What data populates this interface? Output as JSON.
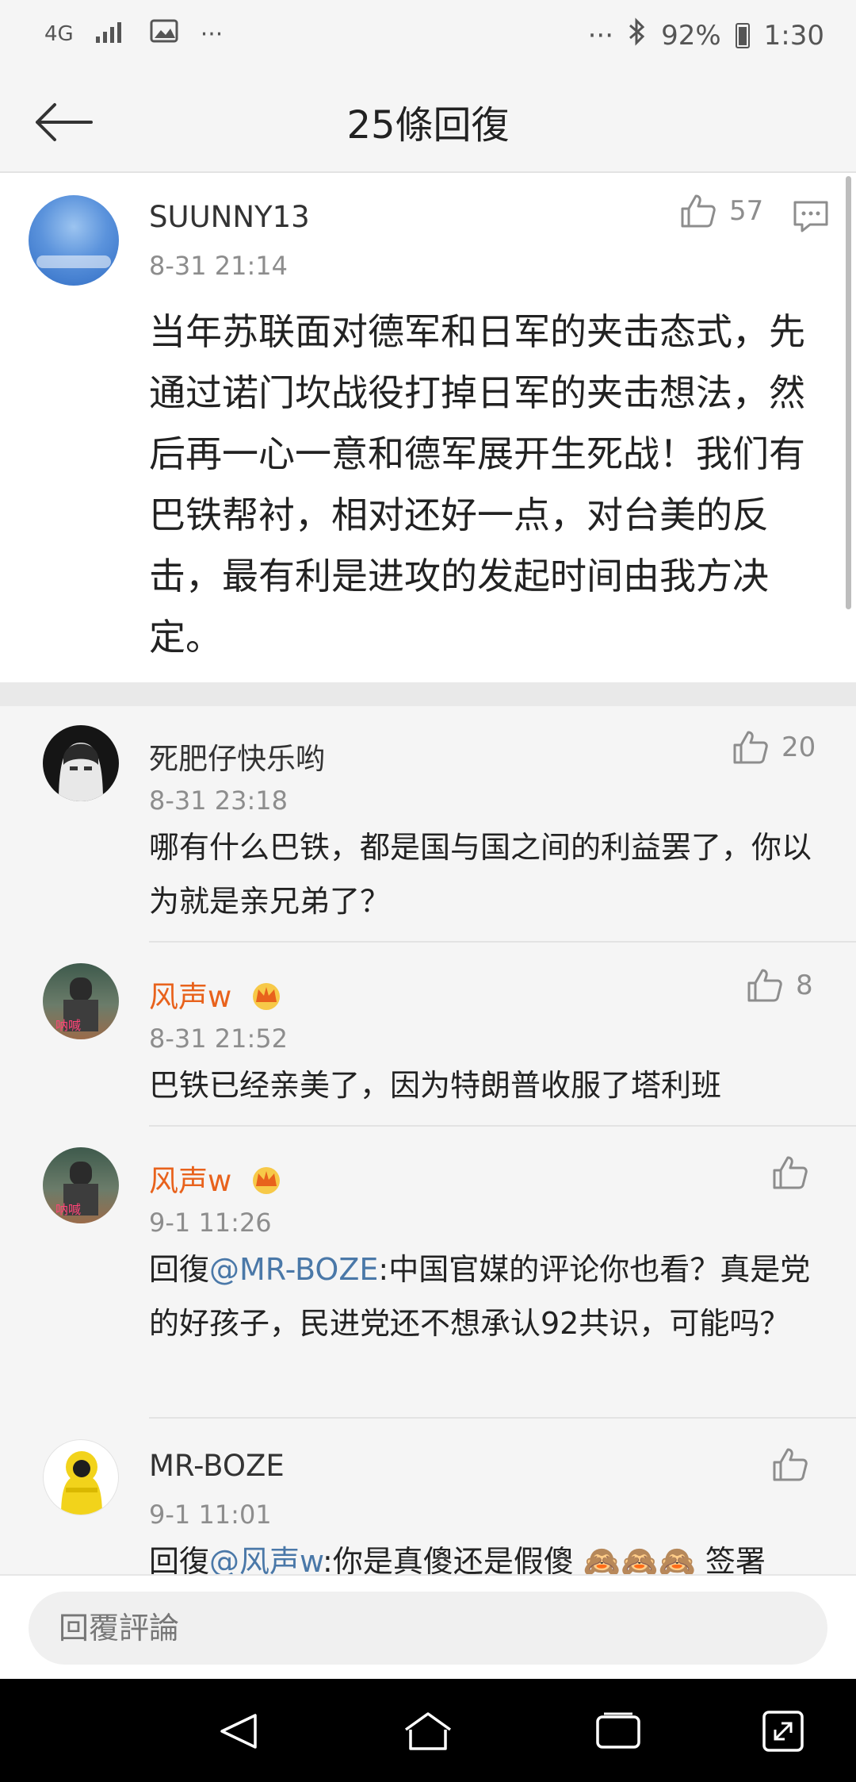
{
  "status_bar": {
    "network": "4G",
    "more_left": "···",
    "more_right": "···",
    "battery": "92%",
    "time": "1:30"
  },
  "header": {
    "title": "25條回復"
  },
  "main_comment": {
    "username": "SUUNNY13",
    "timestamp": "8-31 21:14",
    "likes": "57",
    "body": "当年苏联面对德军和日军的夹击态式，先通过诺门坎战役打掉日军的夹击想法，然后再一心一意和德军展开生死战！我们有巴铁帮衬，相对还好一点，对台美的反击，最有利是进攻的发起时间由我方决定。"
  },
  "replies": [
    {
      "username": "死肥仔快乐哟",
      "timestamp": "8-31 23:18",
      "likes": "20",
      "body": "哪有什么巴铁，都是国与国之间的利益罢了，你以为就是亲兄弟了？"
    },
    {
      "username": "风声w",
      "timestamp": "8-31 21:52",
      "likes": "8",
      "body": "巴铁已经亲美了，因为特朗普收服了塔利班"
    },
    {
      "username": "风声w",
      "timestamp": "9-1 11:26",
      "reply_prefix": "回復",
      "mention": "@MR-BOZE",
      "body": ":中国官媒的评论你也看？真是党的好孩子，民进党还不想承认92共识，可能吗？"
    },
    {
      "username": "MR-BOZE",
      "timestamp": "9-1 11:01",
      "reply_prefix": "回復",
      "mention": "@风声w",
      "body": ":你是真傻还是假傻 🙈🙈🙈 签署"
    }
  ],
  "input": {
    "placeholder": "回覆評論"
  },
  "colors": {
    "vip_name": "#e8621c",
    "mention": "#4a78a8",
    "meta_gray": "#8d8d8d"
  },
  "icons": [
    "back-arrow-icon",
    "thumbs-up-icon",
    "comment-icon",
    "crown-icon",
    "nav-back-icon",
    "nav-home-icon",
    "nav-recents-icon",
    "nav-expand-icon"
  ]
}
